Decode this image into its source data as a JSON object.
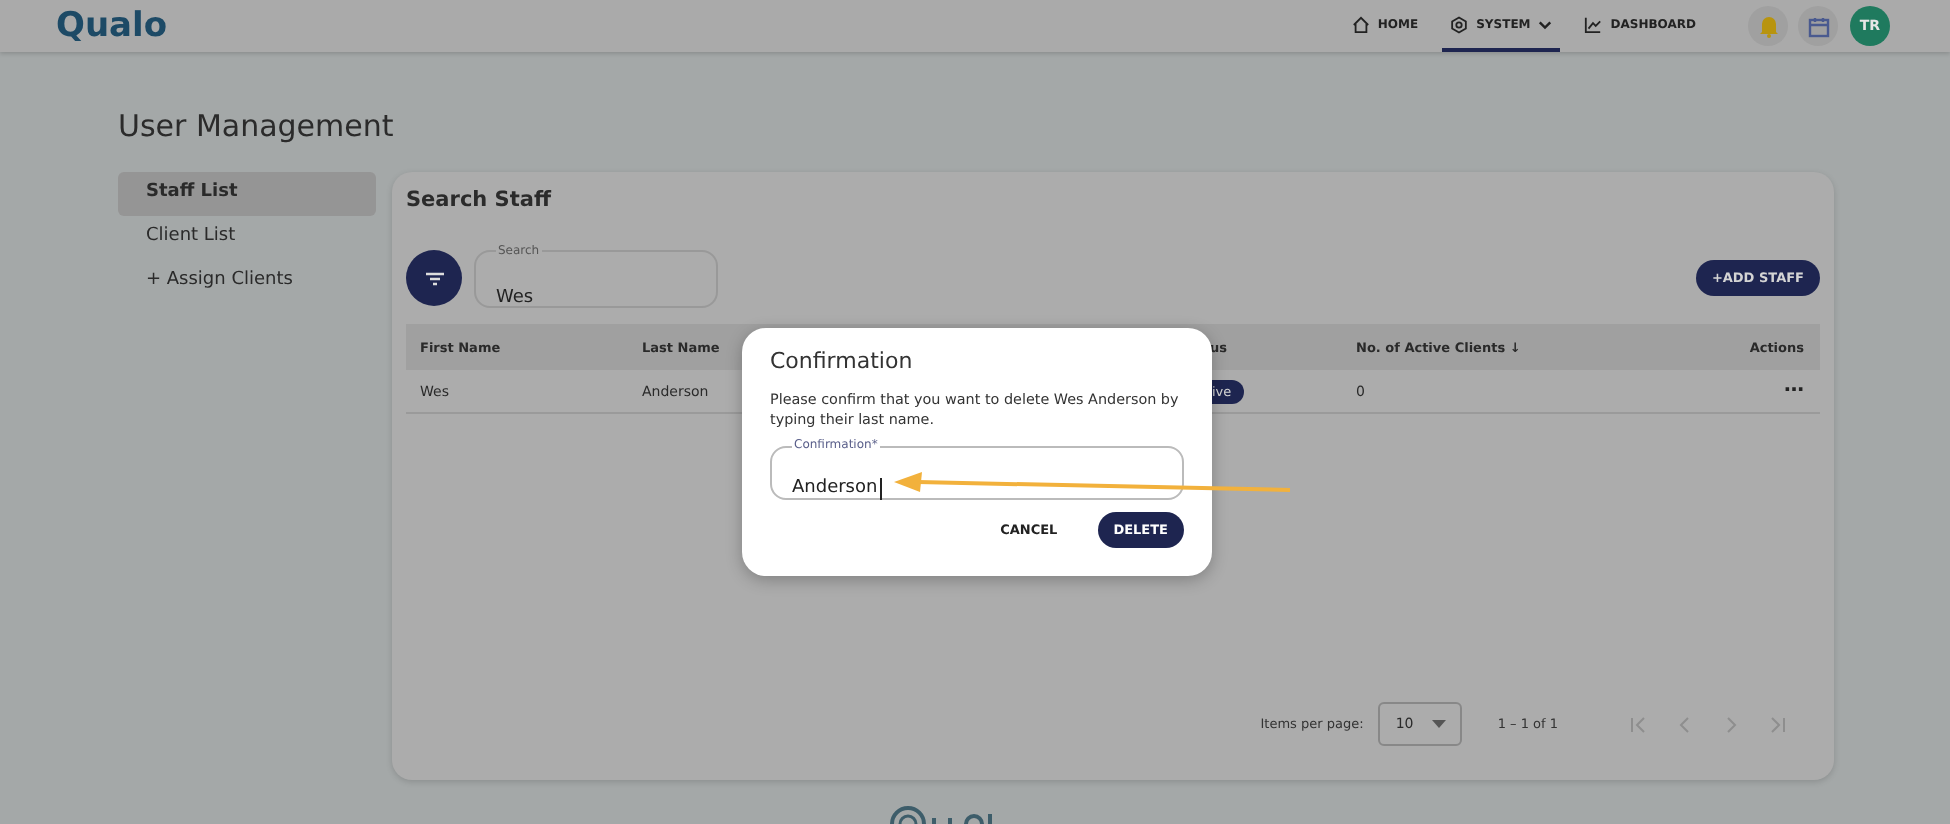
{
  "header": {
    "logo": "Qualo",
    "nav": [
      {
        "label": "HOME",
        "kind": "link",
        "selected": false
      },
      {
        "label": "SYSTEM",
        "kind": "menu",
        "selected": true
      },
      {
        "label": "DASHBOARD",
        "kind": "link",
        "selected": false
      }
    ],
    "avatar": "TR"
  },
  "page_title": "User Management",
  "sidebar": {
    "items": [
      {
        "label": "Staff List",
        "selected": true
      },
      {
        "label": "Client List",
        "selected": false
      },
      {
        "label": "+ Assign Clients",
        "selected": false
      }
    ]
  },
  "card": {
    "title": "Search Staff",
    "search": {
      "label": "Search",
      "value": "Wes"
    },
    "add_button": "+ADD STAFF",
    "table": {
      "columns": [
        "First Name",
        "Last Name",
        "us",
        "No. of Active Clients ↓",
        "Actions"
      ],
      "rows": [
        {
          "first_name": "Wes",
          "last_name": "Anderson",
          "status": "ive",
          "active_clients": "0",
          "actions": "⋯"
        }
      ]
    },
    "pagination": {
      "label": "Items per page:",
      "page_size": "10",
      "range": "1 – 1 of 1"
    }
  },
  "dialog": {
    "title": "Confirmation",
    "message": "Please confirm that you want to delete Wes Anderson by typing their last name.",
    "field": {
      "label": "Confirmation*",
      "value": "Anderson"
    },
    "buttons": [
      {
        "label": "CANCEL",
        "kind": "text"
      },
      {
        "label": "DELETE",
        "kind": "primary"
      }
    ]
  }
}
